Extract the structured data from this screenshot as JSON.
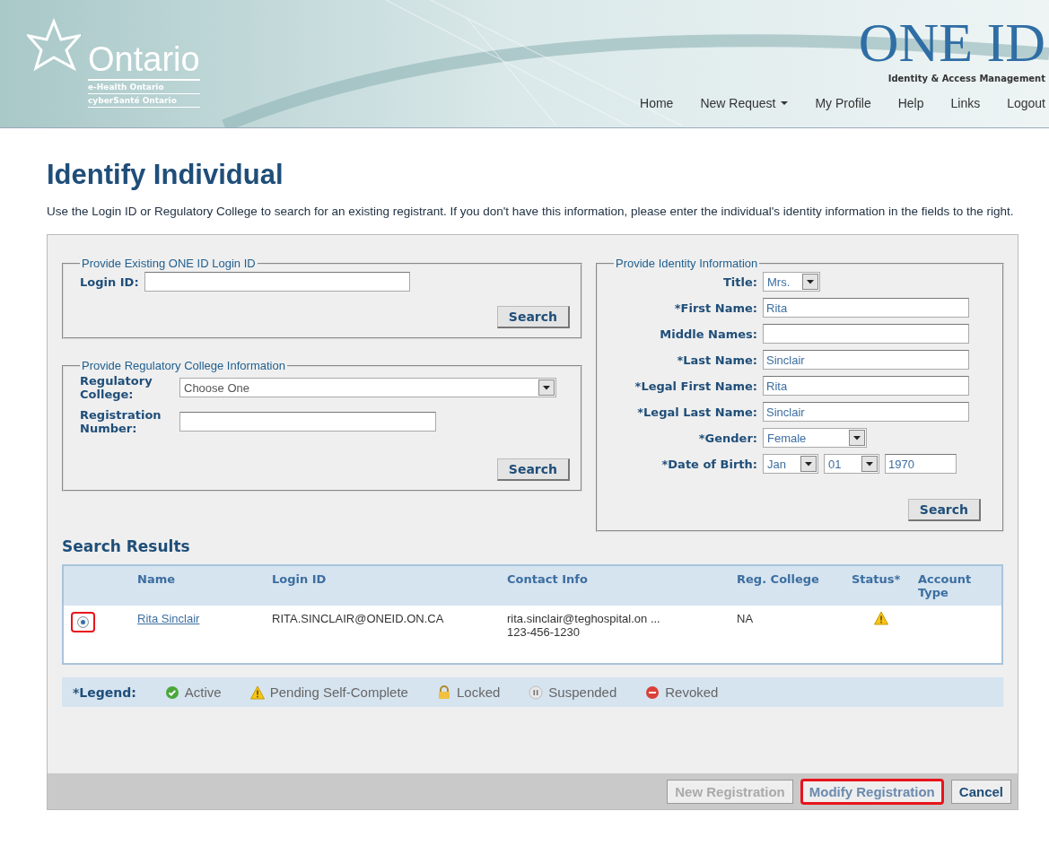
{
  "header": {
    "brand": "Ontario",
    "subtitle_1": "e-Health Ontario",
    "subtitle_2": "cyberSanté Ontario",
    "product": "ONE ID",
    "product_tagline": "Identity & Access Management",
    "nav": [
      {
        "label": "Home",
        "dropdown": false
      },
      {
        "label": "New Request",
        "dropdown": true
      },
      {
        "label": "My Profile",
        "dropdown": false
      },
      {
        "label": "Help",
        "dropdown": false
      },
      {
        "label": "Links",
        "dropdown": false
      },
      {
        "label": "Logout",
        "dropdown": false
      }
    ]
  },
  "page_title": "Identify Individual",
  "description": "Use the Login ID or Regulatory College to search for an existing registrant. If you don't have this information, please enter the individual's identity information in the fields to the right.",
  "login_section": {
    "legend": "Provide Existing ONE ID Login ID",
    "fields": [
      {
        "label": "Login ID:",
        "kind": "text"
      }
    ],
    "button": "Search"
  },
  "college_section": {
    "legend": "Provide Regulatory College Information",
    "fields": [
      {
        "label": "Regulatory College:",
        "kind": "select",
        "value": "Choose One"
      },
      {
        "label": "Registration Number:",
        "kind": "text"
      }
    ],
    "button": "Search"
  },
  "identity_section": {
    "legend": "Provide Identity Information",
    "fields": [
      {
        "label": "Title:",
        "kind": "select",
        "value": "Mrs."
      },
      {
        "label": "*First Name:",
        "kind": "text",
        "value": "Rita"
      },
      {
        "label": "Middle Names:",
        "kind": "text"
      },
      {
        "label": "*Last Name:",
        "kind": "text",
        "value": "Sinclair"
      },
      {
        "label": "*Legal First Name:",
        "kind": "text",
        "value": "Rita"
      },
      {
        "label": "*Legal Last Name:",
        "kind": "text",
        "value": "Sinclair"
      },
      {
        "label": "*Gender:",
        "kind": "select",
        "value": "Female"
      },
      {
        "label": "*Date of Birth:",
        "kind": "date",
        "month": "Jan",
        "day": "01",
        "year": "1970"
      }
    ],
    "button": "Search"
  },
  "results": {
    "title": "Search Results",
    "columns": [
      "Name",
      "Login ID",
      "Contact Info",
      "Reg. College",
      "Status*",
      "Account Type"
    ],
    "rows": [
      {
        "selected": true,
        "highlighted": true,
        "name": "Rita Sinclair",
        "login_id": "RITA.SINCLAIR@ONEID.ON.CA",
        "contact_email": "rita.sinclair@teghospital.on ...",
        "contact_phone": "123-456-1230",
        "reg_college": "NA",
        "status": {
          "kind": "pending"
        }
      }
    ]
  },
  "legend": {
    "label": "*Legend:",
    "items": [
      {
        "kind": "active",
        "label": "Active"
      },
      {
        "kind": "pending",
        "label": "Pending Self-Complete"
      },
      {
        "kind": "locked",
        "label": "Locked"
      },
      {
        "kind": "suspended",
        "label": "Suspended"
      },
      {
        "kind": "revoked",
        "label": "Revoked"
      }
    ]
  },
  "actions": [
    {
      "label": "New Registration",
      "disabled": true,
      "highlighted": false
    },
    {
      "label": "Modify Registration",
      "disabled": false,
      "highlighted": true
    },
    {
      "label": "Cancel",
      "disabled": false,
      "highlighted": false
    }
  ]
}
